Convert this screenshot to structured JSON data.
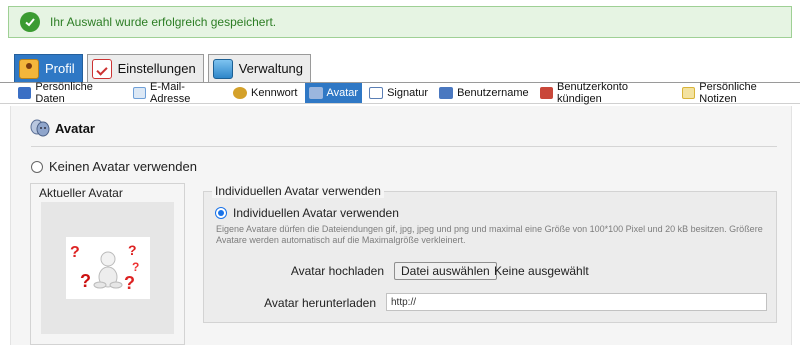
{
  "notice": {
    "message": "Ihr Auswahl wurde erfolgreich gespeichert."
  },
  "main_tabs": [
    {
      "label": "Profil",
      "active": true
    },
    {
      "label": "Einstellungen",
      "active": false
    },
    {
      "label": "Verwaltung",
      "active": false
    }
  ],
  "subnav": [
    {
      "label": "Persönliche Daten",
      "icon": "id-card-icon",
      "color": "#3b6fc4"
    },
    {
      "label": "E-Mail-Adresse",
      "icon": "email-card-icon",
      "color": "#6fa0d8"
    },
    {
      "label": "Kennwort",
      "icon": "keys-icon",
      "color": "#d4a12a"
    },
    {
      "label": "Avatar",
      "icon": "avatar-masks-icon",
      "color": "#9bb6de",
      "active": true
    },
    {
      "label": "Signatur",
      "icon": "pen-sign-icon",
      "color": "#5b7fb5"
    },
    {
      "label": "Benutzername",
      "icon": "user-card-icon",
      "color": "#4a78c0"
    },
    {
      "label": "Benutzerkonto kündigen",
      "icon": "delete-account-icon",
      "color": "#c9473a"
    },
    {
      "label": "Persönliche Notizen",
      "icon": "notepad-icon",
      "color": "#d9b43a"
    }
  ],
  "section": {
    "title": "Avatar"
  },
  "no_avatar": {
    "label": "Keinen Avatar verwenden",
    "checked": false
  },
  "current_avatar": {
    "legend": "Aktueller Avatar"
  },
  "custom_avatar": {
    "legend": "Individuellen Avatar verwenden",
    "radio_label": "Individuellen Avatar verwenden",
    "checked": true,
    "hint": "Eigene Avatare dürfen die Dateiendungen gif, jpg, jpeg und png und maximal eine Größe von 100*100 Pixel und 20 kB besitzen. Größere Avatare werden automatisch auf die Maximalgröße verkleinert.",
    "upload_label": "Avatar hochladen",
    "file_button": "Datei auswählen",
    "file_status": "Keine ausgewählt",
    "download_label": "Avatar herunterladen",
    "download_value": "http://"
  },
  "colors": {
    "accent": "#2f78c5",
    "success_bg": "#e6f4e3",
    "success_text": "#2c7d24"
  }
}
